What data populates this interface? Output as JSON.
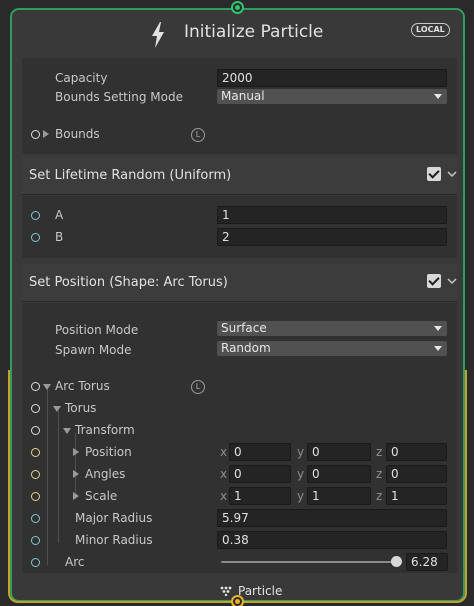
{
  "node": {
    "title": "Initialize Particle",
    "badge": "LOCAL",
    "icon": "lightning-bolt-icon",
    "output_context": "Particle",
    "border_color_top": "#2f9d5f",
    "border_color_bottom": "#c5a227"
  },
  "settings": {
    "capacity_label": "Capacity",
    "capacity_value": "2000",
    "bounds_mode_label": "Bounds Setting Mode",
    "bounds_mode_value": "Manual",
    "bounds_label": "Bounds",
    "bounds_space": "L"
  },
  "lifetime_block": {
    "title": "Set Lifetime Random (Uniform)",
    "enabled": true,
    "a_label": "A",
    "a_value": "1",
    "b_label": "B",
    "b_value": "2"
  },
  "position_block": {
    "title": "Set Position (Shape: Arc Torus)",
    "enabled": true,
    "position_mode_label": "Position Mode",
    "position_mode_value": "Surface",
    "spawn_mode_label": "Spawn Mode",
    "spawn_mode_value": "Random",
    "arc_torus_label": "Arc Torus",
    "arc_torus_space": "L",
    "torus_label": "Torus",
    "transform_label": "Transform",
    "position": {
      "label": "Position",
      "x": "0",
      "y": "0",
      "z": "0"
    },
    "angles": {
      "label": "Angles",
      "x": "0",
      "y": "0",
      "z": "0"
    },
    "scale": {
      "label": "Scale",
      "x": "1",
      "y": "1",
      "z": "1"
    },
    "axis_x": "x",
    "axis_y": "y",
    "axis_z": "z",
    "major_radius_label": "Major Radius",
    "major_radius_value": "5.97",
    "minor_radius_label": "Minor Radius",
    "minor_radius_value": "0.38",
    "arc_label": "Arc",
    "arc_value": "6.28",
    "arc_slider_fraction": 1.0
  }
}
